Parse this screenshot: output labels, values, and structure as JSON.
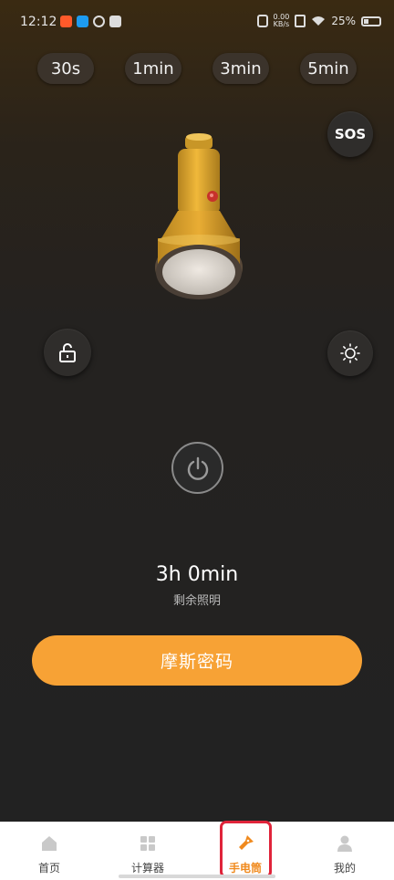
{
  "status_bar": {
    "time": "12:12",
    "net_speed_value": "0.00",
    "net_speed_unit": "KB/s",
    "battery": "25%"
  },
  "timers": [
    {
      "label": "30s"
    },
    {
      "label": "1min"
    },
    {
      "label": "3min"
    },
    {
      "label": "5min"
    }
  ],
  "sos": {
    "label": "SOS"
  },
  "icons": {
    "lock": "unlock-icon",
    "brightness": "sun-icon",
    "power": "power-icon"
  },
  "remaining": {
    "time": "3h 0min",
    "label": "剩余照明"
  },
  "morse_button": {
    "label": "摩斯密码"
  },
  "colors": {
    "accent": "#f7a235",
    "active_nav": "#f08a1e",
    "highlight_box": "#e0243a"
  },
  "bottom_nav": {
    "items": [
      {
        "label": "首页",
        "icon": "home-icon"
      },
      {
        "label": "计算器",
        "icon": "calculator-icon"
      },
      {
        "label": "手电筒",
        "icon": "flashlight-icon",
        "active": true
      },
      {
        "label": "我的",
        "icon": "profile-icon"
      }
    ]
  }
}
